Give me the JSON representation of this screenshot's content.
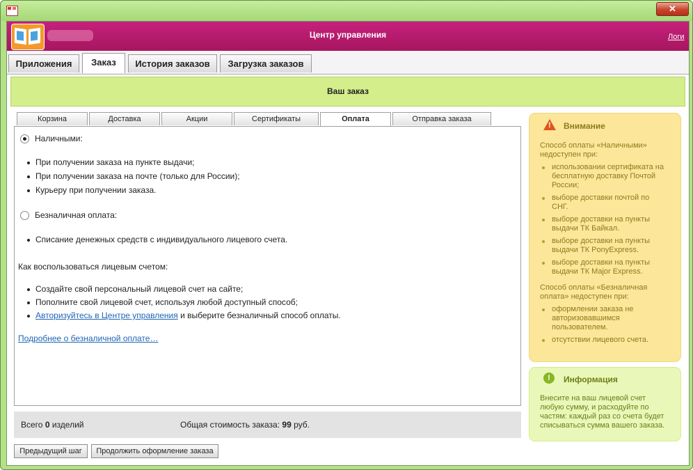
{
  "window": {
    "close_symbol": "✕",
    "icon": "app-icon"
  },
  "header": {
    "title": "Центр управления",
    "logout": "Логи",
    "accent": "#b81b6e"
  },
  "tabs": [
    {
      "label": "Приложения",
      "active": false
    },
    {
      "label": "Заказ",
      "active": true
    },
    {
      "label": "История заказов",
      "active": false
    },
    {
      "label": "Загрузка заказов",
      "active": false
    }
  ],
  "order_bar": {
    "title": "Ваш заказ"
  },
  "subtabs": [
    {
      "label": "Корзина",
      "active": false
    },
    {
      "label": "Доставка",
      "active": false
    },
    {
      "label": "Акции",
      "active": false
    },
    {
      "label": "Сертификаты",
      "active": false
    },
    {
      "label": "Оплата",
      "active": true
    },
    {
      "label": "Отправка заказа",
      "active": false
    }
  ],
  "payment": {
    "cash": {
      "label": "Наличными:",
      "selected": true,
      "items": [
        "При получении заказа на пункте выдачи;",
        "При получении заказа на почте (только для России);",
        "Курьеру при получении заказа."
      ]
    },
    "cashless": {
      "label": "Безналичная оплата:",
      "selected": false,
      "items": [
        "Списание денежных средств с индивидуального лицевого счета."
      ]
    },
    "howto": {
      "title": "Как воспользоваться лицевым счетом:",
      "items": [
        "Создайте свой персональный лицевой счет на сайте;",
        "Пополните свой лицевой счет, используя любой доступный способ;"
      ],
      "login_link": "Авторизуйтесь в Центре управления",
      "login_tail": " и выберите безналичный способ оплаты."
    },
    "more_link": "Подробнее о безналичной оплате…"
  },
  "totals": {
    "items_prefix": "Всего",
    "items_count": "0",
    "items_suffix": "изделий",
    "cost_label": "Общая стоимость заказа:",
    "cost_value": "99",
    "cost_unit": "руб."
  },
  "buttons": {
    "prev": "Предыдущий шаг",
    "next": "Продолжить оформление заказа"
  },
  "warning": {
    "title": "Внимание",
    "icon": "warning-icon",
    "cash_intro": [
      "Способ оплаты «Наличными»",
      "недоступен при:"
    ],
    "cash_items": [
      [
        "использовании сертификата на",
        "бесплатную доставку Почтой",
        "России;"
      ],
      [
        "выборе доставки почтой по",
        "СНГ."
      ],
      [
        "выборе доставки на пункты",
        "выдачи ТК Байкал."
      ],
      [
        "выборе доставки на пункты",
        "выдачи ТК PonyExpress."
      ],
      [
        "выборе доставки на пункты",
        "выдачи ТК Major Express."
      ]
    ],
    "cashless_intro": [
      "Способ оплаты «Безналичная",
      "оплата» недоступен при:"
    ],
    "cashless_items": [
      [
        "оформлении заказа не",
        "авторизовавшимся",
        "пользователем."
      ],
      [
        "отсутствии лицевого счета."
      ]
    ]
  },
  "info": {
    "title": "Информация",
    "icon": "info-icon",
    "text": [
      "Внесите на ваш лицевой счет",
      "любую сумму, и расходуйте по",
      "частям: каждый раз со счета будет",
      "списываться сумма вашего заказа."
    ]
  }
}
